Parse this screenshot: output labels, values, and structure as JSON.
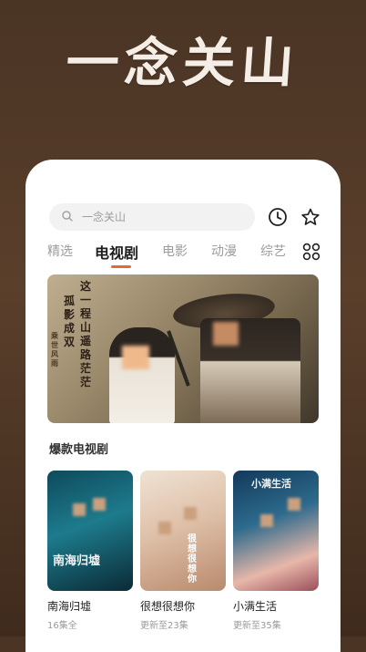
{
  "brand_title": "一念关山",
  "search": {
    "placeholder": "一念关山"
  },
  "icons": {
    "search": "search-icon",
    "history": "clock-icon",
    "favorite": "star-icon",
    "categories": "grid-icon"
  },
  "tabs": [
    {
      "label": "精选",
      "active": false
    },
    {
      "label": "电视剧",
      "active": true
    },
    {
      "label": "电影",
      "active": false
    },
    {
      "label": "动漫",
      "active": false
    },
    {
      "label": "综艺",
      "active": false
    }
  ],
  "banner": {
    "poem_lines": [
      "这一程山遥路茫茫",
      "孤影成双"
    ],
    "tagline": "乘世风雨"
  },
  "section": {
    "title": "爆款电视剧"
  },
  "cards": [
    {
      "title": "南海归墟",
      "subtitle": "16集全",
      "poster_text": "南海归墟"
    },
    {
      "title": "很想很想你",
      "subtitle": "更新至23集",
      "poster_text": "很想很想你"
    },
    {
      "title": "小满生活",
      "subtitle": "更新至35集",
      "poster_text": "小满生活"
    }
  ],
  "colors": {
    "accent": "#e26a3a",
    "background": "#4a3424"
  }
}
